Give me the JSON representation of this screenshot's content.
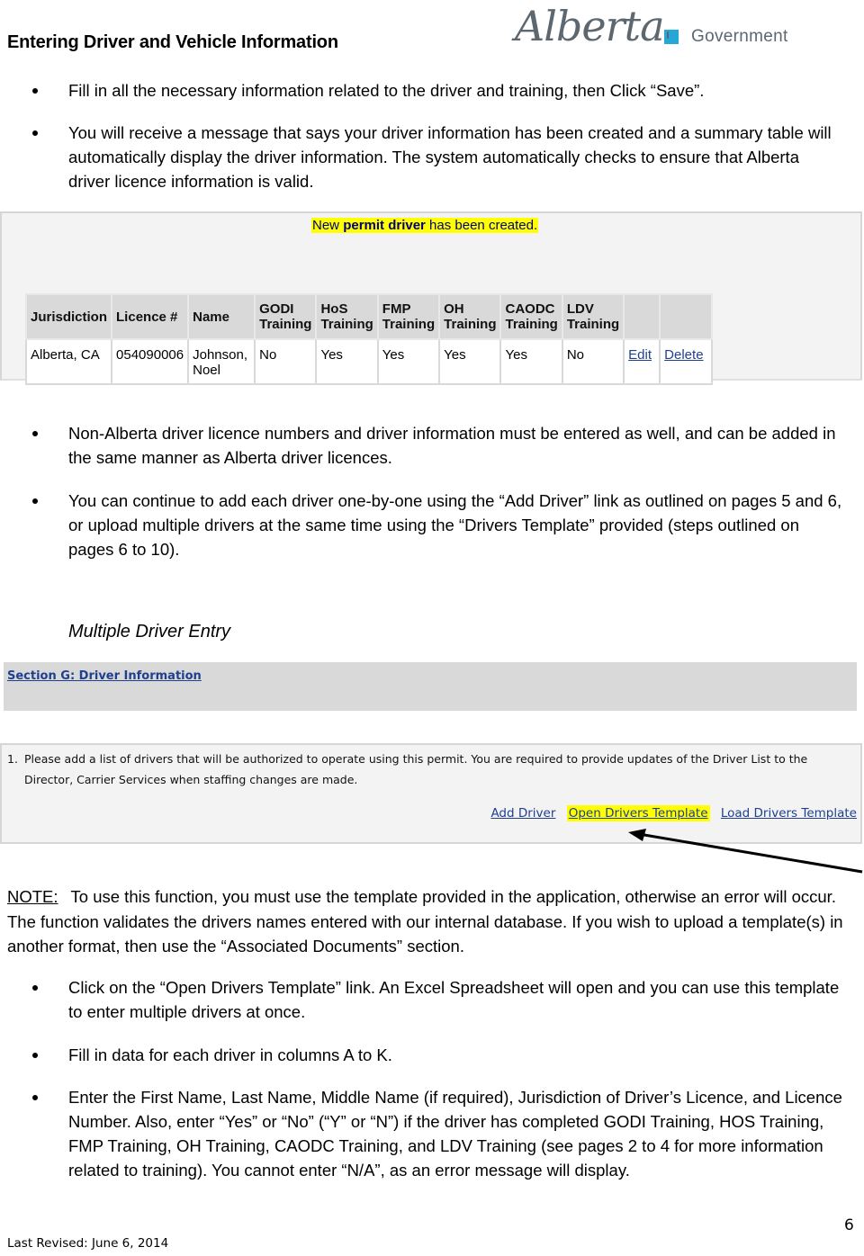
{
  "header": {
    "title": "Entering Driver and Vehicle Information",
    "logo": {
      "script_text": "Alberta",
      "government_text": "Government",
      "accent_color": "#25a7d8",
      "text_color": "#5d6770"
    }
  },
  "bullets_top": [
    "Fill in all the necessary information related to the driver and training, then Click “Save”.",
    "You will receive a message that says your driver information has been created and a summary table will automatically display the driver information.  The system automatically checks to ensure that Alberta driver licence information is valid."
  ],
  "confirmation": {
    "prefix": "New ",
    "bold": "permit driver",
    "suffix": " has been created.",
    "highlight_color": "#ffff00"
  },
  "drivers_table": {
    "headers": [
      [
        "Jurisdiction"
      ],
      [
        "Licence #"
      ],
      [
        "Name"
      ],
      [
        "GODI",
        "Training"
      ],
      [
        "HoS",
        "Training"
      ],
      [
        "FMP",
        "Training"
      ],
      [
        "OH",
        "Training"
      ],
      [
        "CAODC",
        "Training"
      ],
      [
        "LDV",
        "Training"
      ],
      [
        ""
      ],
      [
        ""
      ]
    ],
    "rows": [
      {
        "jurisdiction": "Alberta, CA",
        "licence": "054090006",
        "name_line1": "Johnson,",
        "name_line2": "Noel",
        "godi": "No",
        "hos": "Yes",
        "fmp": "Yes",
        "oh": "Yes",
        "caodc": "Yes",
        "ldv": "No",
        "edit_label": "Edit",
        "delete_label": "Delete"
      }
    ]
  },
  "bullets_middle": [
    "Non-Alberta driver licence numbers and driver information must be entered as well, and can be added in the same manner as Alberta driver licences.",
    "You can continue to add each driver one-by-one using the “Add Driver” link as outlined on pages 5 and 6, or upload multiple drivers at the same time using the “Drivers Template” provided (steps outlined on pages 6 to 10)."
  ],
  "subheading": "Multiple Driver Entry",
  "section_g": {
    "link_label": "Section G: Driver Information"
  },
  "instruction": {
    "number": "1.",
    "text": "Please add a list of drivers that will be authorized to operate using this permit. You are required to provide updates of the Driver List to the Director, Carrier Services when staffing changes are made."
  },
  "links": {
    "add_driver": "Add Driver",
    "open_template": "Open Drivers Template",
    "load_template": "Load Drivers Template"
  },
  "note": {
    "label": "NOTE:",
    "text": "To use this function, you must use the template provided in the application, otherwise an error will occur.  The function validates the drivers names entered with our internal database.  If you wish to upload a template(s) in another format, then use the “Associated Documents” section."
  },
  "bullets_bottom": [
    "Click on the “Open Drivers Template” link.  An Excel Spreadsheet will open and you can use this template to enter multiple drivers at once.",
    "Fill in data for each driver in columns A to K.",
    "Enter the First Name, Last Name, Middle Name (if required), Jurisdiction of Driver’s Licence, and Licence Number.  Also, enter “Yes” or “No”  (“Y” or “N”) if the driver has completed GODI Training, HOS Training, FMP Training, OH Training, CAODC Training, and LDV Training (see pages 2 to 4 for more information related to training).  You cannot enter “N/A”, as an error message will display."
  ],
  "footer": {
    "last_revised": "Last Revised:  June 6, 2014",
    "page_number": "6"
  }
}
